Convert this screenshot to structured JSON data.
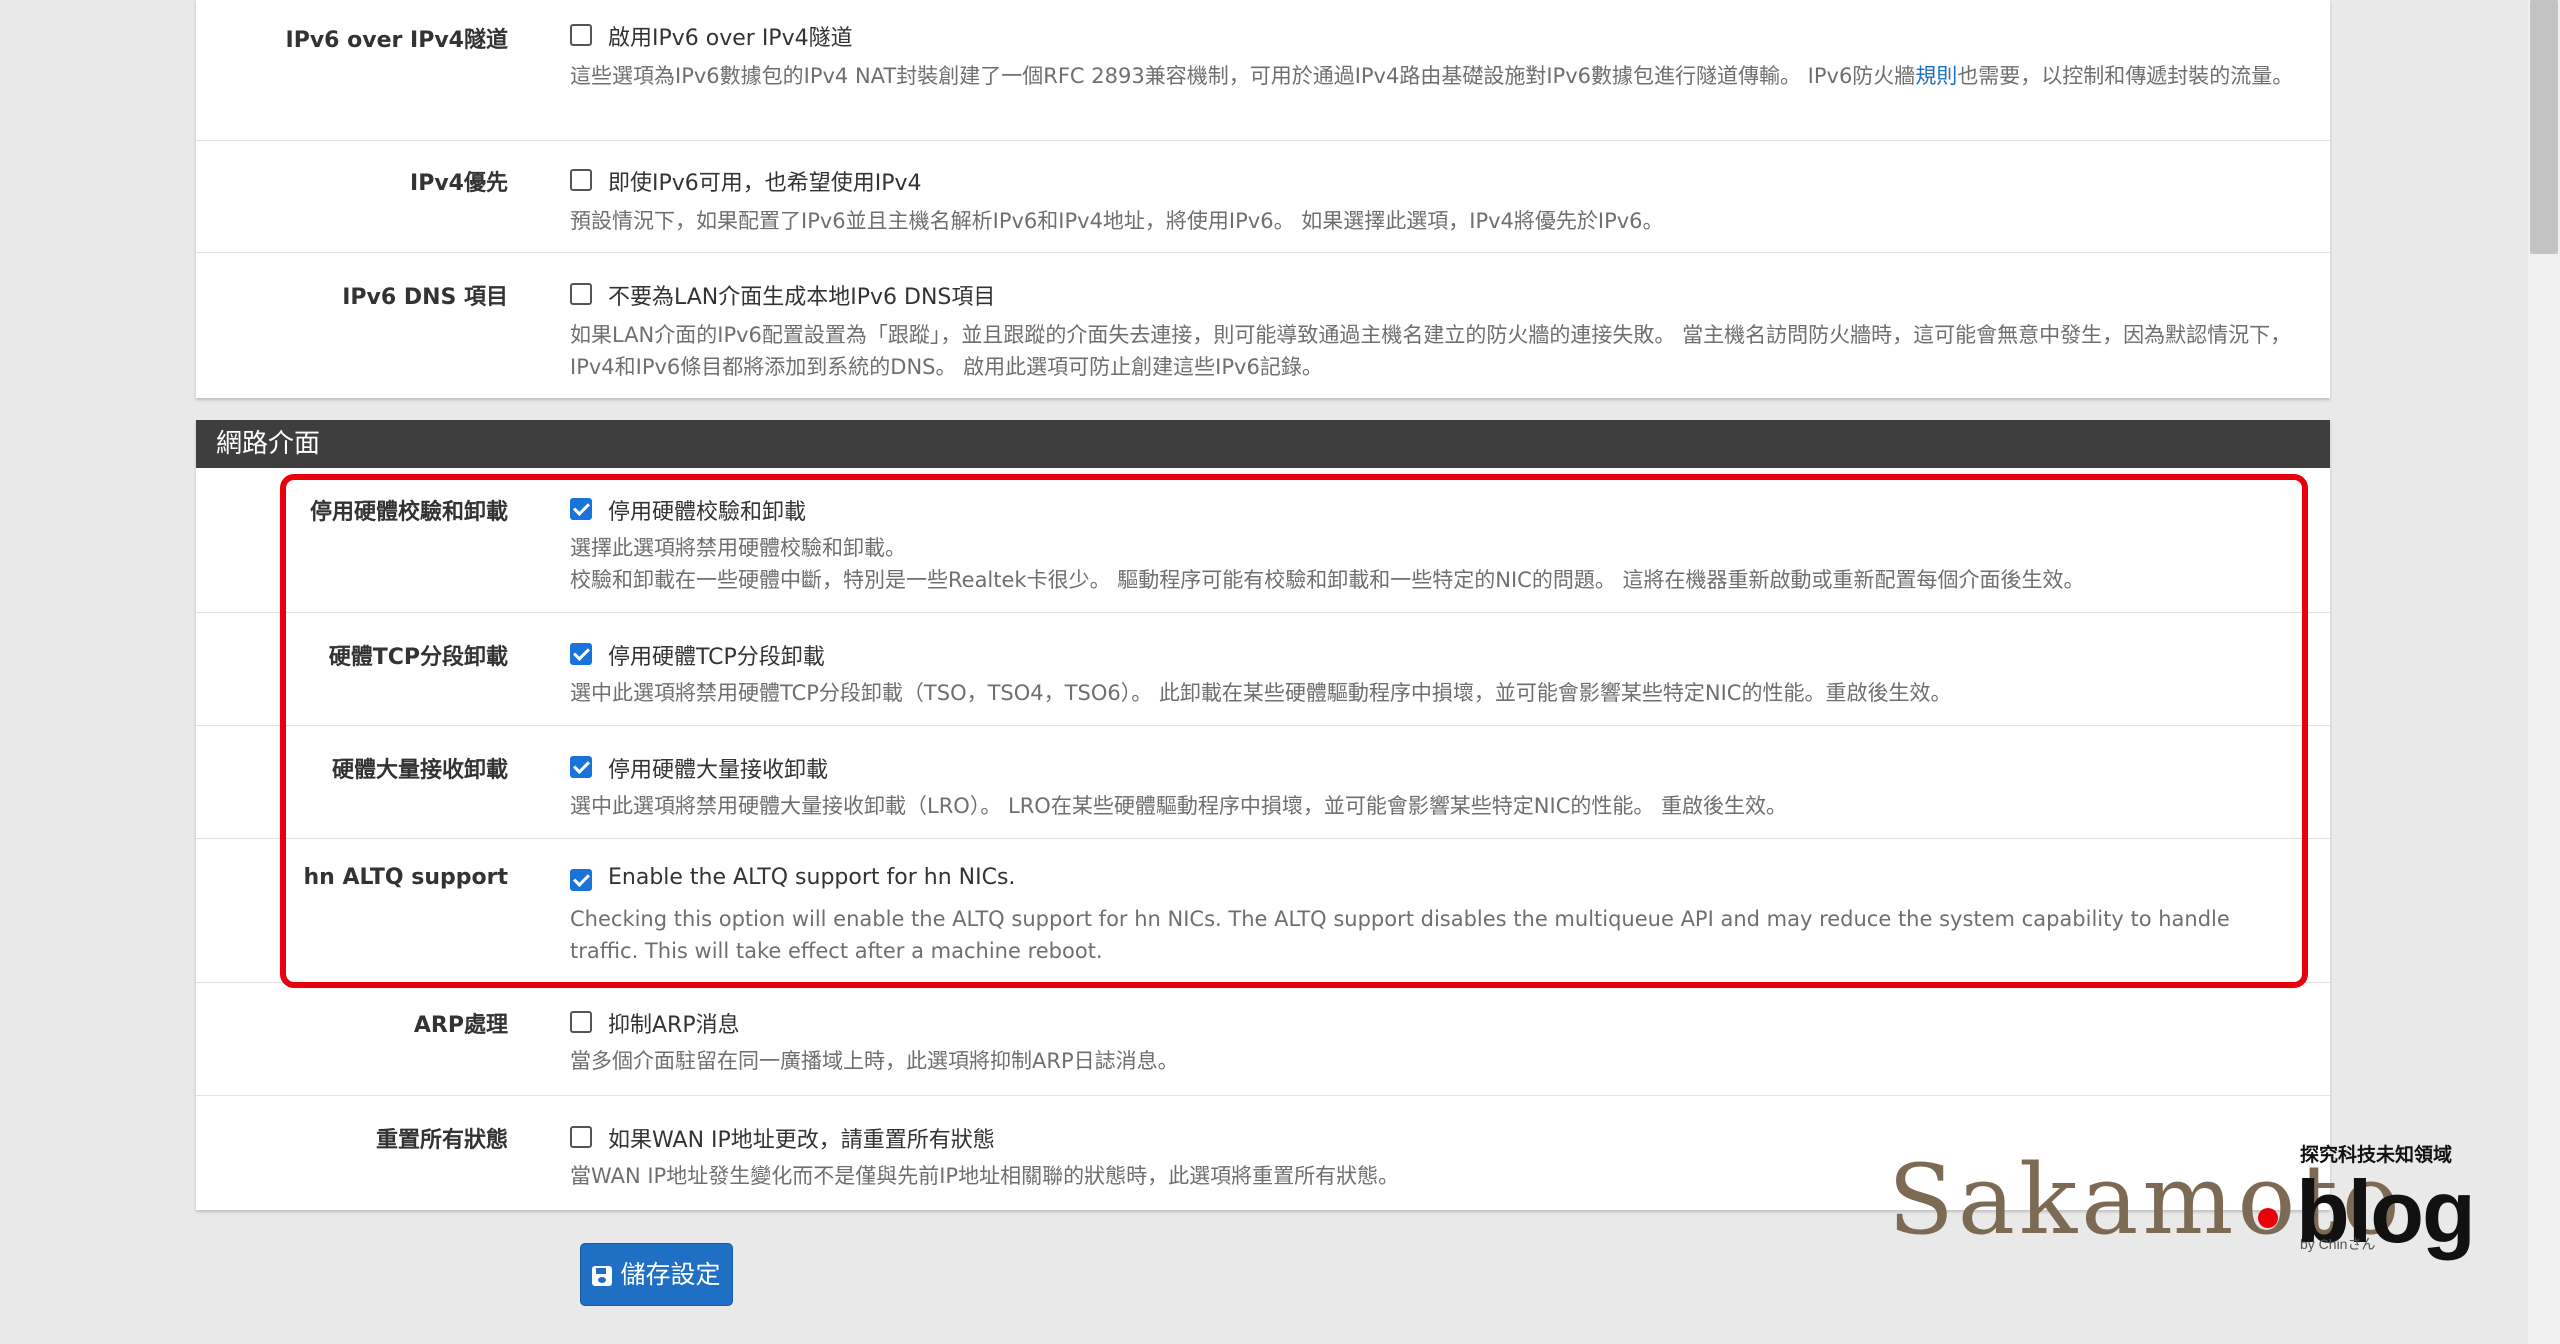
{
  "sections": {
    "ipv6": {
      "rows": [
        {
          "label": "IPv6 over IPv4隧道",
          "checkbox_label": "啟用IPv6 over IPv4隧道",
          "checked": false,
          "help_before": "這些選項為IPv6數據包的IPv4 NAT封裝創建了一個RFC 2893兼容機制，可用於通過IPv4路由基礎設施對IPv6數據包進行隧道傳輸。 IPv6防火牆",
          "help_link": "規則",
          "help_after": "也需要，以控制和傳遞封裝的流量。"
        },
        {
          "label": "IPv4優先",
          "checkbox_label": "即使IPv6可用，也希望使用IPv4",
          "checked": false,
          "help": "預設情況下，如果配置了IPv6並且主機名解析IPv6和IPv4地址，將使用IPv6。 如果選擇此選項，IPv4將優先於IPv6。"
        },
        {
          "label": "IPv6 DNS 項目",
          "checkbox_label": "不要為LAN介面生成本地IPv6 DNS項目",
          "checked": false,
          "help": "如果LAN介面的IPv6配置設置為「跟蹤」，並且跟蹤的介面失去連接，則可能導致通過主機名建立的防火牆的連接失敗。 當主機名訪問防火牆時，這可能會無意中發生，因為默認情況下，IPv4和IPv6條目都將添加到系統的DNS。 啟用此選項可防止創建這些IPv6記錄。"
        }
      ]
    },
    "network": {
      "heading": "網路介面",
      "rows": [
        {
          "label": "停用硬體校驗和卸載",
          "checkbox_label": "停用硬體校驗和卸載",
          "checked": true,
          "help_line1": "選擇此選項將禁用硬體校驗和卸載。",
          "help_line2": "校驗和卸載在一些硬體中斷，特別是一些Realtek卡很少。 驅動程序可能有校驗和卸載和一些特定的NIC的問題。 這將在機器重新啟動或重新配置每個介面後生效。"
        },
        {
          "label": "硬體TCP分段卸載",
          "checkbox_label": "停用硬體TCP分段卸載",
          "checked": true,
          "help": "選中此選項將禁用硬體TCP分段卸載（TSO，TSO4，TSO6）。 此卸載在某些硬體驅動程序中損壞，並可能會影響某些特定NIC的性能。重啟後生效。"
        },
        {
          "label": "硬體大量接收卸載",
          "checkbox_label": "停用硬體大量接收卸載",
          "checked": true,
          "help": "選中此選項將禁用硬體大量接收卸載（LRO）。 LRO在某些硬體驅動程序中損壞，並可能會影響某些特定NIC的性能。 重啟後生效。"
        },
        {
          "label": "hn ALTQ support",
          "checkbox_label": "Enable the ALTQ support for hn NICs.",
          "checked": true,
          "help": "Checking this option will enable the ALTQ support for hn NICs. The ALTQ support disables the multiqueue API and may reduce the system capability to handle traffic. This will take effect after a machine reboot."
        },
        {
          "label": "ARP處理",
          "checkbox_label": "抑制ARP消息",
          "checked": false,
          "help": "當多個介面駐留在同一廣播域上時，此選項將抑制ARP日誌消息。"
        },
        {
          "label": "重置所有狀態",
          "checkbox_label": "如果WAN IP地址更改，請重置所有狀態",
          "checked": false,
          "help": "當WAN IP地址發生變化而不是僅與先前IP地址相關聯的狀態時，此選項將重置所有狀態。"
        }
      ]
    }
  },
  "save_button": {
    "label": "儲存設定",
    "icon": "floppy-disk-icon"
  },
  "watermark": {
    "script_text": "Sakamoto",
    "brand_text": "blog",
    "tagline": "探究科技未知領域",
    "byline": "by Chinさん"
  },
  "colors": {
    "highlight_border": "#e8000b",
    "checkbox_checked": "#1a73d9",
    "heading_bg": "#3e3e3e",
    "button_bg": "#1f6fc4",
    "link": "#1f6fc4"
  }
}
